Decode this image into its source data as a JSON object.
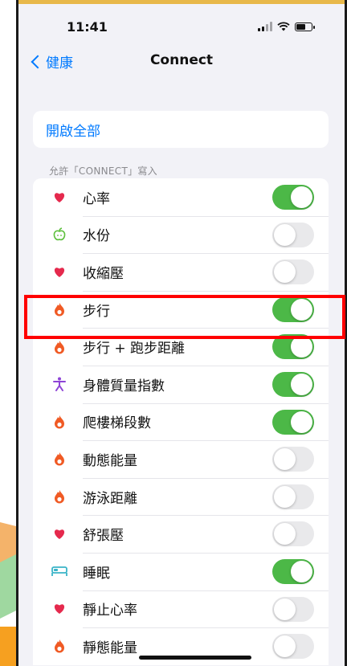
{
  "status_bar": {
    "time": "11:41"
  },
  "nav": {
    "back_label": "健康",
    "title": "Connect"
  },
  "enable_all_label": "開啟全部",
  "section_header": "允許「CONNECT」寫入",
  "colors": {
    "accent": "#007aff",
    "toggle_on": "#4cb847",
    "toggle_off": "#e9e9eb",
    "heart": "#e5294d",
    "flame": "#f05a24",
    "person": "#8e44d6",
    "bed": "#3ab4c8",
    "apple": "#5cbf3b",
    "highlight": "#ff0000"
  },
  "rows": [
    {
      "label": "心率",
      "icon": "heart-icon",
      "on": true
    },
    {
      "label": "水份",
      "icon": "apple-icon",
      "on": false
    },
    {
      "label": "收縮壓",
      "icon": "heart-icon",
      "on": false
    },
    {
      "label": "步行",
      "icon": "flame-icon",
      "on": true
    },
    {
      "label": "步行 + 跑步距離",
      "icon": "flame-icon",
      "on": true
    },
    {
      "label": "身體質量指數",
      "icon": "person-icon",
      "on": true
    },
    {
      "label": "爬樓梯段數",
      "icon": "flame-icon",
      "on": true
    },
    {
      "label": "動態能量",
      "icon": "flame-icon",
      "on": false
    },
    {
      "label": "游泳距離",
      "icon": "flame-icon",
      "on": false
    },
    {
      "label": "舒張壓",
      "icon": "heart-icon",
      "on": false
    },
    {
      "label": "睡眠",
      "icon": "bed-icon",
      "on": true
    },
    {
      "label": "靜止心率",
      "icon": "heart-icon",
      "on": false
    },
    {
      "label": "靜態能量",
      "icon": "flame-icon",
      "on": false
    }
  ]
}
